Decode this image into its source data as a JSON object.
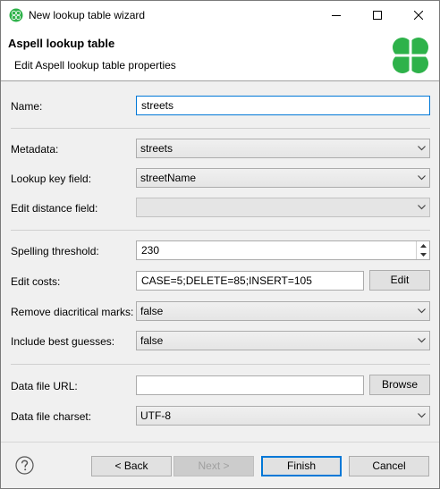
{
  "window": {
    "title": "New lookup table wizard",
    "icon": "clover-icon"
  },
  "banner": {
    "title": "Aspell lookup table",
    "subtitle": "Edit Aspell lookup table properties",
    "logo": "clover-logo-icon"
  },
  "form": {
    "name": {
      "label": "Name:",
      "value": "streets"
    },
    "metadata": {
      "label": "Metadata:",
      "value": "streets"
    },
    "lookup_key": {
      "label": "Lookup key field:",
      "value": "streetName"
    },
    "edit_distance": {
      "label": "Edit distance field:",
      "value": ""
    },
    "spelling_threshold": {
      "label": "Spelling threshold:",
      "value": "230"
    },
    "edit_costs": {
      "label": "Edit costs:",
      "value": "CASE=5;DELETE=85;INSERT=105",
      "button": "Edit"
    },
    "remove_diacritical": {
      "label": "Remove diacritical marks:",
      "value": "false"
    },
    "include_best_guesses": {
      "label": "Include best guesses:",
      "value": "false"
    },
    "data_file_url": {
      "label": "Data file URL:",
      "value": "",
      "button": "Browse"
    },
    "data_file_charset": {
      "label": "Data file charset:",
      "value": "UTF-8"
    }
  },
  "footer": {
    "back": "< Back",
    "next": "Next >",
    "finish": "Finish",
    "cancel": "Cancel"
  },
  "colors": {
    "accent": "#0078d7",
    "clover_green": "#2eb24a"
  }
}
